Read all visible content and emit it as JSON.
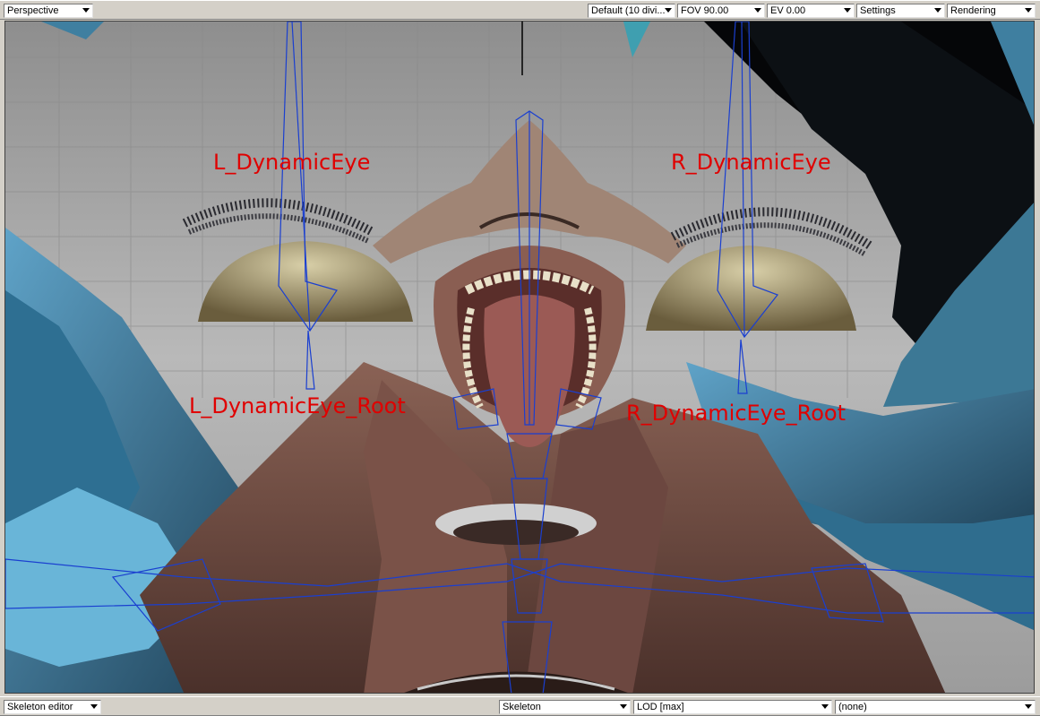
{
  "toolbar": {
    "view_mode": "Perspective",
    "grid_preset": "Default (10 divi...",
    "fov": "FOV 90.00",
    "ev": "EV  0.00",
    "settings": "Settings",
    "rendering": "Rendering"
  },
  "viewport": {
    "bone_labels": {
      "l_eye": "L_DynamicEye",
      "r_eye": "R_DynamicEye",
      "l_eye_root": "L_DynamicEye_Root",
      "r_eye_root": "R_DynamicEye_Root"
    },
    "colors": {
      "bone_wire": "#1a3fd0",
      "label": "#e00000",
      "skin": "#6e4a40",
      "cloth": "#3f7fa0"
    }
  },
  "statusbar": {
    "editor_mode": "Skeleton editor",
    "display_mode": "Skeleton",
    "lod": "LOD [max]",
    "selection": "(none)"
  }
}
